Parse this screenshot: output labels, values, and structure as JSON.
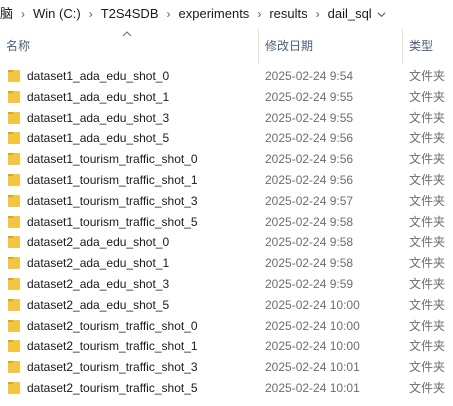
{
  "breadcrumb": {
    "items": [
      "脑",
      "Win (C:)",
      "T2S4SDB",
      "experiments",
      "results",
      "dail_sql"
    ],
    "separator": "›",
    "dropdown_icon": "chevron-down-icon"
  },
  "columns": {
    "name": "名称",
    "date": "修改日期",
    "type": "类型",
    "sort_icon": "sort-up-icon"
  },
  "colors": {
    "header_text": "#4c607a",
    "folder_yellow": "#f4c542",
    "folder_dark": "#e0a800",
    "secondary_text": "#6d6d6d"
  },
  "files": [
    {
      "name": "dataset1_ada_edu_shot_0",
      "date": "2025-02-24 9:54",
      "type": "文件夹"
    },
    {
      "name": "dataset1_ada_edu_shot_1",
      "date": "2025-02-24 9:55",
      "type": "文件夹"
    },
    {
      "name": "dataset1_ada_edu_shot_3",
      "date": "2025-02-24 9:55",
      "type": "文件夹"
    },
    {
      "name": "dataset1_ada_edu_shot_5",
      "date": "2025-02-24 9:56",
      "type": "文件夹"
    },
    {
      "name": "dataset1_tourism_traffic_shot_0",
      "date": "2025-02-24 9:56",
      "type": "文件夹"
    },
    {
      "name": "dataset1_tourism_traffic_shot_1",
      "date": "2025-02-24 9:56",
      "type": "文件夹"
    },
    {
      "name": "dataset1_tourism_traffic_shot_3",
      "date": "2025-02-24 9:57",
      "type": "文件夹"
    },
    {
      "name": "dataset1_tourism_traffic_shot_5",
      "date": "2025-02-24 9:58",
      "type": "文件夹"
    },
    {
      "name": "dataset2_ada_edu_shot_0",
      "date": "2025-02-24 9:58",
      "type": "文件夹"
    },
    {
      "name": "dataset2_ada_edu_shot_1",
      "date": "2025-02-24 9:58",
      "type": "文件夹"
    },
    {
      "name": "dataset2_ada_edu_shot_3",
      "date": "2025-02-24 9:59",
      "type": "文件夹"
    },
    {
      "name": "dataset2_ada_edu_shot_5",
      "date": "2025-02-24 10:00",
      "type": "文件夹"
    },
    {
      "name": "dataset2_tourism_traffic_shot_0",
      "date": "2025-02-24 10:00",
      "type": "文件夹"
    },
    {
      "name": "dataset2_tourism_traffic_shot_1",
      "date": "2025-02-24 10:00",
      "type": "文件夹"
    },
    {
      "name": "dataset2_tourism_traffic_shot_3",
      "date": "2025-02-24 10:01",
      "type": "文件夹"
    },
    {
      "name": "dataset2_tourism_traffic_shot_5",
      "date": "2025-02-24 10:01",
      "type": "文件夹"
    }
  ]
}
